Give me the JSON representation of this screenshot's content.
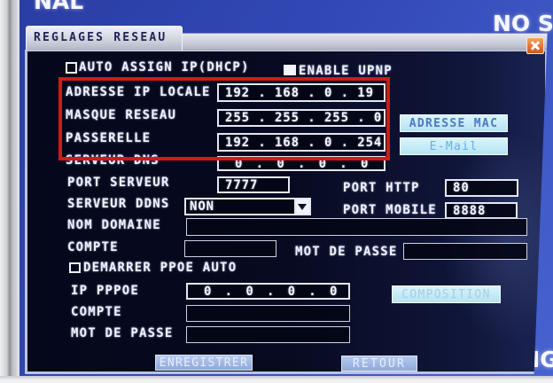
{
  "screen": {
    "partial_text_top_left": "NAL",
    "partial_text_top_right": "NO S",
    "partial_text_bottom_right": "IG"
  },
  "dialog": {
    "title": "REGLAGES RESEAU",
    "close_icon": "close-icon",
    "dhcp": {
      "label": "AUTO ASSIGN IP(DHCP)",
      "checked": false
    },
    "upnp": {
      "label": "ENABLE UPNP",
      "checked": true
    },
    "local_ip": {
      "label": "ADRESSE IP LOCALE",
      "value": "192 . 168 . 0 . 19"
    },
    "subnet_mask": {
      "label": "MASQUE RESEAU",
      "value": "255 . 255 . 255 . 0"
    },
    "gateway": {
      "label": "PASSERELLE",
      "value": "192 . 168 . 0 . 254"
    },
    "dns_server": {
      "label": "SERVEUR DNS",
      "value": "0 . 0 . 0 . 0"
    },
    "server_port": {
      "label": "PORT SERVEUR",
      "value": "7777"
    },
    "http_port": {
      "label": "PORT HTTP",
      "value": "80"
    },
    "ddns_server": {
      "label": "SERVEUR DDNS",
      "selected": "NON",
      "icon": "chevron-down-icon"
    },
    "mobile_port": {
      "label": "PORT MOBILE",
      "value": "8888"
    },
    "domain_name": {
      "label": "NOM DOMAINE",
      "value": ""
    },
    "account": {
      "label": "COMPTE",
      "value": ""
    },
    "password": {
      "label": "MOT DE PASSE",
      "value": ""
    },
    "pppoe_autostart": {
      "label": "DEMARRER PPOE AUTO",
      "checked": false
    },
    "pppoe_ip": {
      "label": "IP PPPOE",
      "value": "0 . 0 . 0 . 0"
    },
    "pppoe_account": {
      "label": "COMPTE",
      "value": ""
    },
    "pppoe_password": {
      "label": "MOT DE PASSE",
      "value": ""
    },
    "buttons": {
      "mac_address": "ADRESSE MAC",
      "email": "E-Mail",
      "composition": "COMPOSITION",
      "save": "ENREGISTRER",
      "back": "RETOUR"
    }
  },
  "colors": {
    "screen_blue": "#3249b6",
    "dialog_bg": "#05071b",
    "highlight": "#d21a1a",
    "close_button": "#e8722a",
    "label_text": "#eef1ff"
  }
}
